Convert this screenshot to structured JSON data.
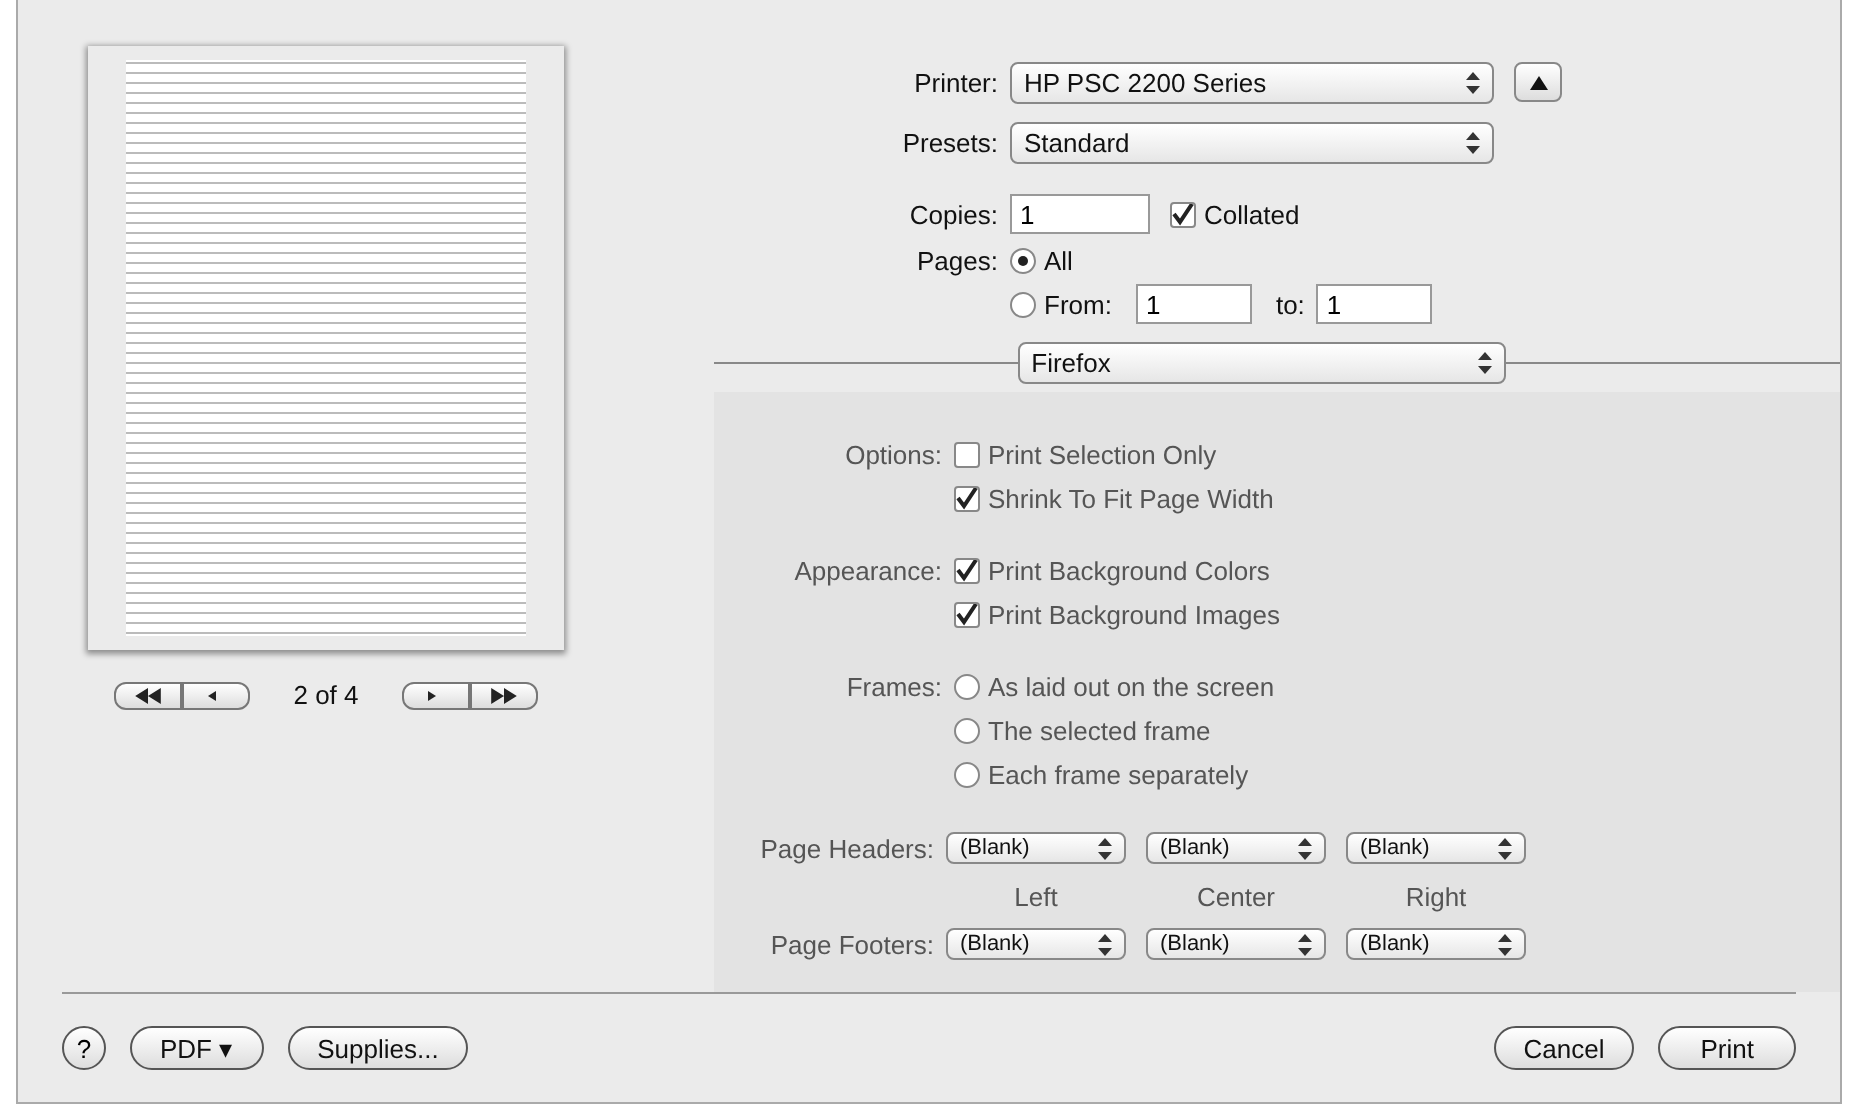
{
  "printer": {
    "label": "Printer:",
    "value": "HP PSC 2200 Series"
  },
  "details_toggle": {
    "expanded": true
  },
  "presets": {
    "label": "Presets:",
    "value": "Standard"
  },
  "copies": {
    "label": "Copies:",
    "value": "1",
    "collated": {
      "label": "Collated",
      "checked": true
    }
  },
  "pages": {
    "label": "Pages:",
    "options": [
      {
        "label": "All",
        "selected": true
      },
      {
        "label": "From:",
        "selected": false
      }
    ],
    "from": "1",
    "to_label": "to:",
    "to": "1"
  },
  "preview": {
    "page_indicator": "2 of 4"
  },
  "panel_menu": {
    "value": "Firefox"
  },
  "sections": [
    {
      "label": "Options:",
      "kind": "checkbox",
      "items": [
        {
          "label": "Print Selection Only",
          "checked": false
        },
        {
          "label": "Shrink To Fit Page Width",
          "checked": true
        }
      ]
    },
    {
      "label": "Appearance:",
      "kind": "checkbox",
      "items": [
        {
          "label": "Print Background Colors",
          "checked": true
        },
        {
          "label": "Print Background Images",
          "checked": true
        }
      ]
    },
    {
      "label": "Frames:",
      "kind": "radio",
      "items": [
        {
          "label": "As laid out on the screen",
          "selected": false
        },
        {
          "label": "The selected frame",
          "selected": false
        },
        {
          "label": "Each frame separately",
          "selected": false
        }
      ]
    }
  ],
  "page_headers": {
    "label": "Page Headers:",
    "values": [
      "(Blank)",
      "(Blank)",
      "(Blank)"
    ]
  },
  "positions": [
    "Left",
    "Center",
    "Right"
  ],
  "page_footers": {
    "label": "Page Footers:",
    "values": [
      "(Blank)",
      "(Blank)",
      "(Blank)"
    ]
  },
  "buttons": {
    "help": "?",
    "pdf": "PDF ▾",
    "supplies": "Supplies...",
    "cancel": "Cancel",
    "print": "Print"
  }
}
